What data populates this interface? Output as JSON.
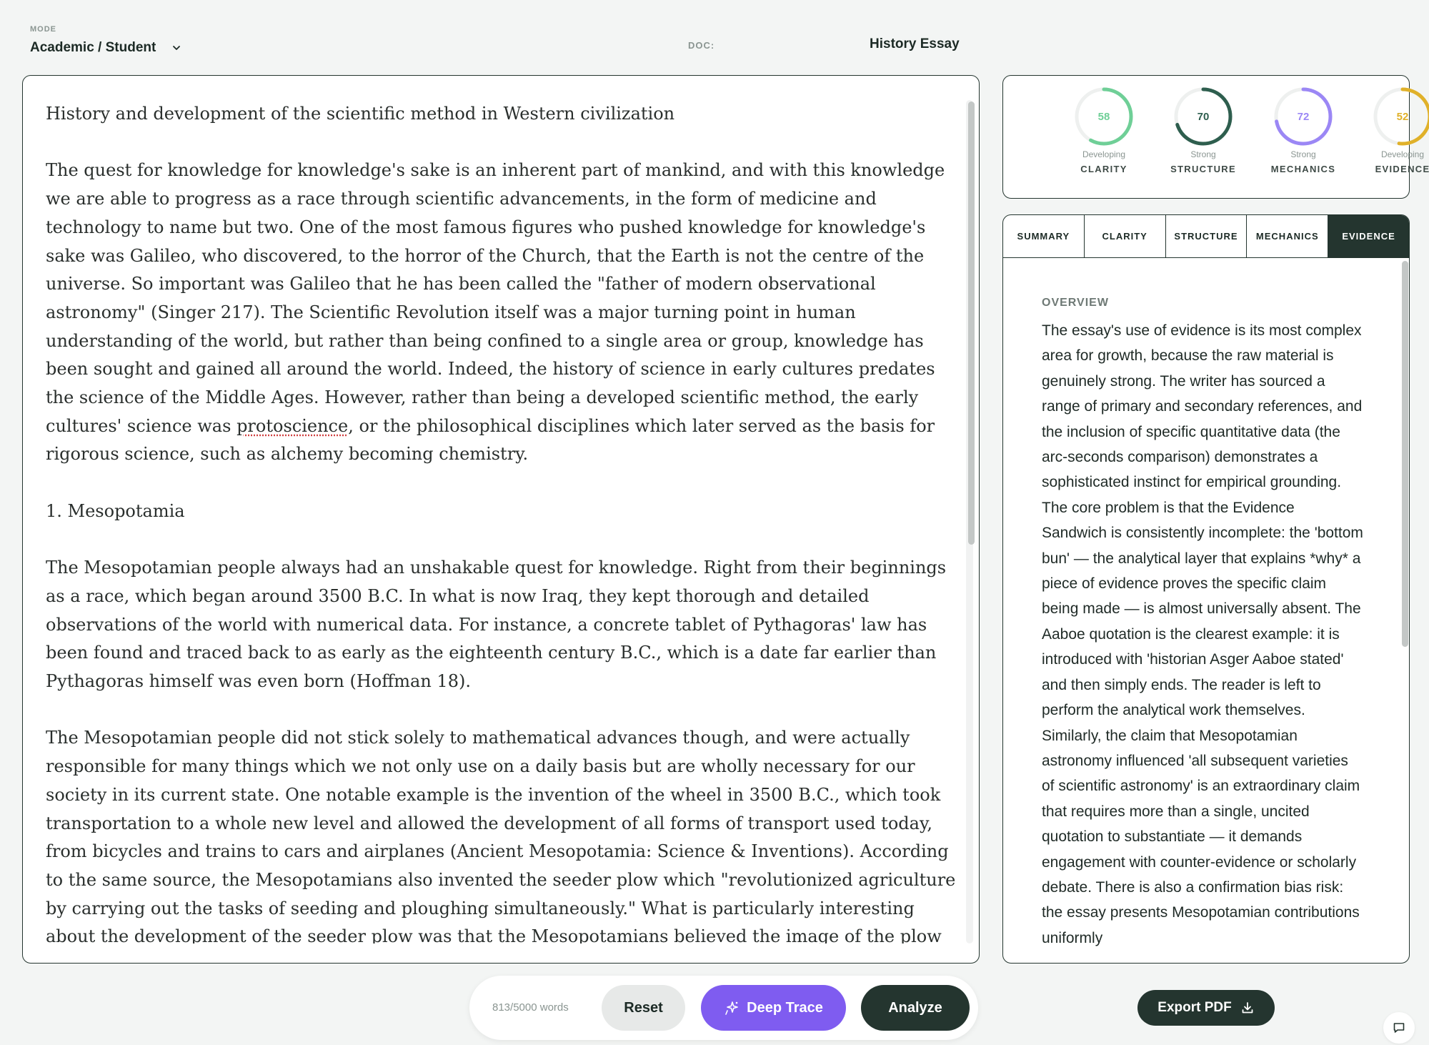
{
  "header": {
    "mode_caption": "MODE",
    "mode_value": "Academic / Student",
    "doc_caption": "DOC:",
    "doc_title": "History Essay"
  },
  "editor": {
    "paragraphs": [
      "History and development of the scientific method in Western civilization",
      "The quest for knowledge for knowledge's sake is an inherent part of mankind, and with this knowledge we are able to progress as a race through scientific advancements, in the form of medicine and technology to name but two. One of the most famous figures who pushed knowledge for knowledge's sake was Galileo, who discovered, to the horror of the Church, that the Earth is not the centre of the universe. So important was Galileo that he has been called the \"father of modern observational astronomy\" (Singer 217). The Scientific Revolution itself was a major turning point in human understanding of the world, but rather than being confined to a single area or group, knowledge has been sought and gained all around the world. Indeed, the history of science in early cultures predates the science of the Middle Ages. However, rather than being a developed scientific method, the early cultures' science was ",
      "protoscience",
      ", or the philosophical disciplines which later served as the basis for rigorous science, such as alchemy becoming chemistry.",
      "1. Mesopotamia",
      "The Mesopotamian people always had an unshakable quest for knowledge. Right from their beginnings as a race, which began around 3500 B.C. In what is now Iraq, they kept thorough and detailed observations of the world with numerical data. For instance, a concrete tablet of Pythagoras' law has been found and traced back to as early as the eighteenth century B.C., which is a date far earlier than Pythagoras himself was even born (Hoffman 18).",
      "The Mesopotamian people did not stick solely to mathematical advances though, and were actually responsible for many things which we not only use on a daily basis but are wholly necessary for our society in its current state. One notable example is the invention of the wheel in 3500 B.C., which took transportation to a whole new level and allowed the development of all forms of transport used today, from bicycles and trains to cars and airplanes (Ancient Mesopotamia: Science & Inventions). According to the same source, the Mesopotamians also invented the seeder plow which \"revolutionized agriculture by carrying out the tasks of seeding and ploughing simultaneously.\" What is particularly interesting about the development of the seeder plow was that the Mesopotamians believed the image of the plow could be seen in the stars, which is how they came to build it. Moreover, they \"discovered that by observing the movements of celestial bodies they could measure time, which was key for planting crops and for holding religious festivals. Their astronomical observations still aid today's scientists.\""
    ]
  },
  "scores": [
    {
      "value": "58",
      "level": "Developing",
      "label": "CLARITY",
      "pct": 0.58,
      "color": "#6fcf97"
    },
    {
      "value": "70",
      "level": "Strong",
      "label": "STRUCTURE",
      "pct": 0.7,
      "color": "#2e5e4e"
    },
    {
      "value": "72",
      "level": "Strong",
      "label": "MECHANICS",
      "pct": 0.72,
      "color": "#9b87f5"
    },
    {
      "value": "52",
      "level": "Developing",
      "label": "EVIDENCE",
      "pct": 0.52,
      "color": "#e0b12a"
    }
  ],
  "tabs": [
    "SUMMARY",
    "CLARITY",
    "STRUCTURE",
    "MECHANICS",
    "EVIDENCE"
  ],
  "active_tab": "EVIDENCE",
  "panel": {
    "overview_heading": "OVERVIEW",
    "overview_text": "The essay's use of evidence is its most complex area for growth, because the raw material is genuinely strong. The writer has sourced a range of primary and secondary references, and the inclusion of specific quantitative data (the arc-seconds comparison) demonstrates a sophisticated instinct for empirical grounding. The core problem is that the Evidence Sandwich is consistently incomplete: the 'bottom bun' — the analytical layer that explains *why* a piece of evidence proves the specific claim being made — is almost universally absent. The Aaboe quotation is the clearest example: it is introduced with 'historian Asger Aaboe stated' and then simply ends. The reader is left to perform the analytical work themselves. Similarly, the claim that Mesopotamian astronomy influenced 'all subsequent varieties of scientific astronomy' is an extraordinary claim that requires more than a single, uncited quotation to substantiate — it demands engagement with counter-evidence or scholarly debate. There is also a confirmation bias risk: the essay presents Mesopotamian contributions uniformly"
  },
  "toolbar": {
    "wordcount": "813/5000 words",
    "reset_label": "Reset",
    "trace_label": "Deep Trace",
    "analyze_label": "Analyze"
  },
  "export_label": "Export PDF"
}
